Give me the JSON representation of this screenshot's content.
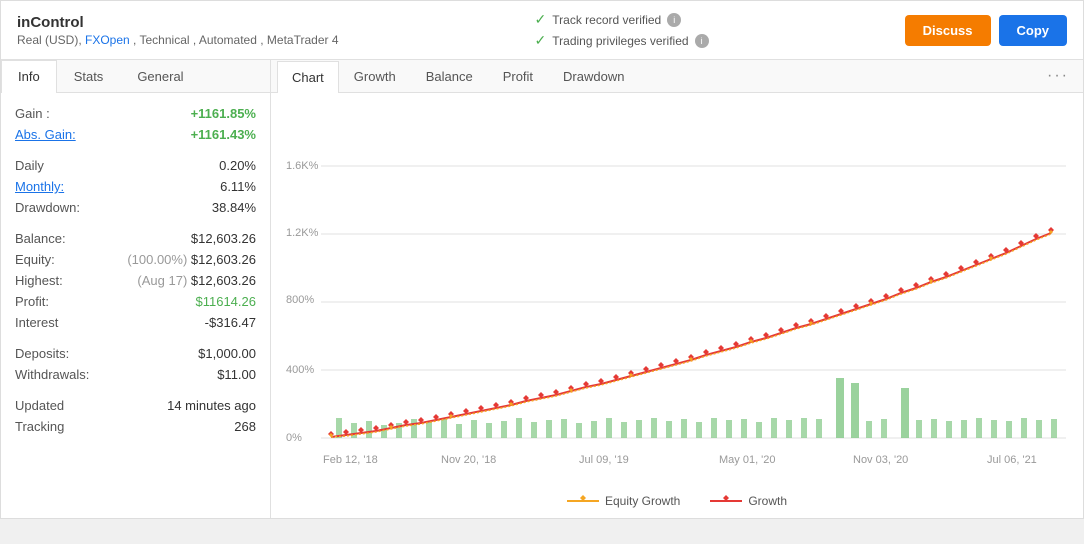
{
  "app": {
    "title": "inControl",
    "subtitle": "Real (USD), FXOpen , Technical , Automated , MetaTrader 4",
    "fxopen_link": "FXOpen"
  },
  "verifications": {
    "track_record": "Track record verified",
    "trading_privileges": "Trading privileges verified"
  },
  "buttons": {
    "discuss": "Discuss",
    "copy": "Copy"
  },
  "left_tabs": [
    {
      "label": "Info",
      "active": true
    },
    {
      "label": "Stats",
      "active": false
    },
    {
      "label": "General",
      "active": false
    }
  ],
  "stats": {
    "gain_label": "Gain :",
    "gain_value": "+1161.85%",
    "abs_gain_label": "Abs. Gain:",
    "abs_gain_value": "+1161.43%",
    "daily_label": "Daily",
    "daily_value": "0.20%",
    "monthly_label": "Monthly:",
    "monthly_value": "6.11%",
    "drawdown_label": "Drawdown:",
    "drawdown_value": "38.84%",
    "balance_label": "Balance:",
    "balance_value": "$12,603.26",
    "equity_label": "Equity:",
    "equity_pct": "(100.00%)",
    "equity_value": "$12,603.26",
    "highest_label": "Highest:",
    "highest_note": "(Aug 17)",
    "highest_value": "$12,603.26",
    "profit_label": "Profit:",
    "profit_value": "$11614.26",
    "interest_label": "Interest",
    "interest_value": "-$316.47",
    "deposits_label": "Deposits:",
    "deposits_value": "$1,000.00",
    "withdrawals_label": "Withdrawals:",
    "withdrawals_value": "$11.00",
    "updated_label": "Updated",
    "updated_value": "14 minutes ago",
    "tracking_label": "Tracking",
    "tracking_value": "268"
  },
  "right_tabs": [
    {
      "label": "Chart",
      "active": true
    },
    {
      "label": "Growth",
      "active": false
    },
    {
      "label": "Balance",
      "active": false
    },
    {
      "label": "Profit",
      "active": false
    },
    {
      "label": "Drawdown",
      "active": false
    }
  ],
  "chart": {
    "y_labels": [
      "0%",
      "400%",
      "800%",
      "1.2K%",
      "1.6K%"
    ],
    "x_labels": [
      "Feb 12, '18",
      "Nov 20, '18",
      "Jul 09, '19",
      "May 01, '20",
      "Nov 03, '20",
      "Jul 06, '21"
    ],
    "legend_equity": "Equity Growth",
    "legend_growth": "Growth"
  }
}
